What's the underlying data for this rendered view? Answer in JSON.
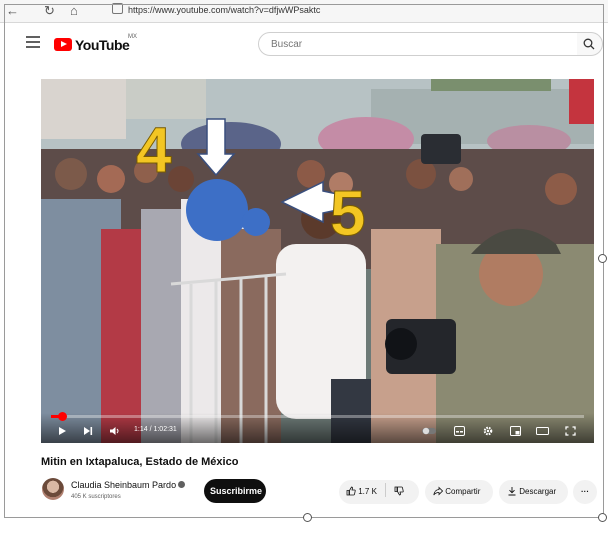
{
  "browser": {
    "url": "https://www.youtube.com/watch?v=dfjwWPsaktc"
  },
  "header": {
    "logo_text": "YouTube",
    "logo_region": "MX",
    "search_placeholder": "Buscar"
  },
  "video": {
    "current_time": "1:14 / 1:02:31",
    "progress_fraction": 0.02,
    "annotations": [
      "4",
      "5"
    ]
  },
  "info": {
    "title": "Mitin en Ixtapaluca, Estado de México",
    "channel_name": "Claudia Sheinbaum Pardo",
    "subscribers": "405 K suscriptores",
    "subscribe_label": "Suscribirme",
    "likes": "1.7 K",
    "share_label": "Compartir",
    "download_label": "Descargar",
    "more_label": "···"
  },
  "colors": {
    "brand_red": "#ff0000",
    "annotation_yellow": "#f3c623",
    "redaction_blue": "#3d6fc6"
  },
  "icons": {
    "back": "back-arrow-icon",
    "reload": "reload-icon",
    "home": "home-icon",
    "search": "search-icon",
    "play": "play-icon",
    "next": "next-icon",
    "volume": "volume-icon",
    "autoplay": "autoplay-toggle-icon",
    "subtitles": "subtitles-icon",
    "settings": "gear-icon",
    "miniplayer": "miniplayer-icon",
    "theater": "theater-mode-icon",
    "fullscreen": "fullscreen-icon",
    "like": "thumbs-up-icon",
    "dislike": "thumbs-down-icon",
    "share": "share-arrow-icon",
    "download": "download-icon"
  }
}
